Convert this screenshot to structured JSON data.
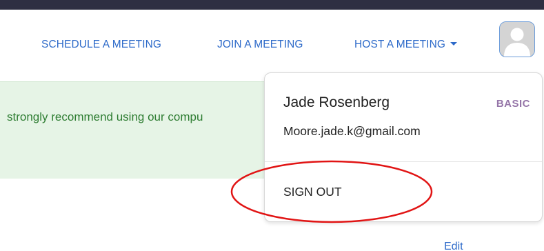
{
  "nav": {
    "schedule_label": "SCHEDULE A MEETING",
    "join_label": "JOIN A MEETING",
    "host_label": "HOST A MEETING"
  },
  "banner": {
    "text": "strongly recommend using our compu"
  },
  "user_menu": {
    "name": "Jade Rosenberg",
    "plan": "BASIC",
    "email": "Moore.jade.k@gmail.com",
    "sign_out_label": "SIGN OUT"
  },
  "page": {
    "edit_label": "Edit"
  },
  "icons": {
    "avatar": "user-avatar-icon",
    "host_caret": "caret-down-icon"
  },
  "colors": {
    "link": "#2d6ac9",
    "top_bar": "#2e2f42",
    "banner_bg": "#e6f4e6",
    "banner_text": "#2e7d32",
    "plan_badge": "#9575a8",
    "annotation": "#e11414"
  }
}
